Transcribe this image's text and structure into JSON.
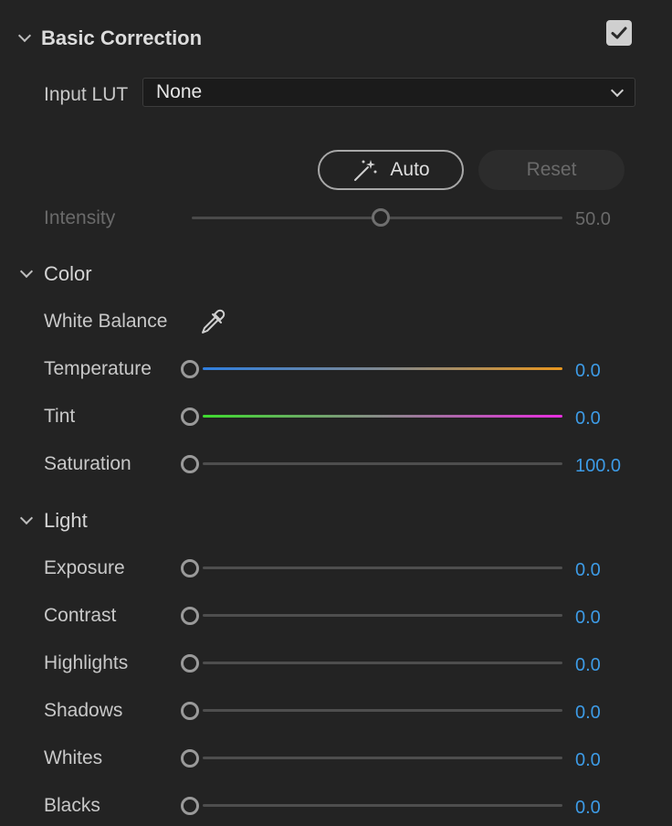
{
  "header": {
    "title": "Basic Correction",
    "enabled": true
  },
  "input_lut": {
    "label": "Input LUT",
    "value": "None"
  },
  "buttons": {
    "auto_label": "Auto",
    "reset_label": "Reset"
  },
  "intensity": {
    "label": "Intensity",
    "value": "50.0",
    "level": 0.5
  },
  "color_section": {
    "title": "Color",
    "white_balance_label": "White Balance",
    "temperature": {
      "label": "Temperature",
      "value": "0.0"
    },
    "tint": {
      "label": "Tint",
      "value": "0.0"
    },
    "saturation": {
      "label": "Saturation",
      "value": "100.0"
    }
  },
  "light_section": {
    "title": "Light",
    "exposure": {
      "label": "Exposure",
      "value": "0.0"
    },
    "contrast": {
      "label": "Contrast",
      "value": "0.0"
    },
    "highlights": {
      "label": "Highlights",
      "value": "0.0"
    },
    "shadows": {
      "label": "Shadows",
      "value": "0.0"
    },
    "whites": {
      "label": "Whites",
      "value": "0.0"
    },
    "blacks": {
      "label": "Blacks",
      "value": "0.0"
    }
  },
  "colors": {
    "accent_value": "#3d9be6",
    "temperature_gradient": [
      "#2f7fe0",
      "#e8961e"
    ],
    "tint_gradient": [
      "#3fdc2f",
      "#e82ee0"
    ]
  }
}
